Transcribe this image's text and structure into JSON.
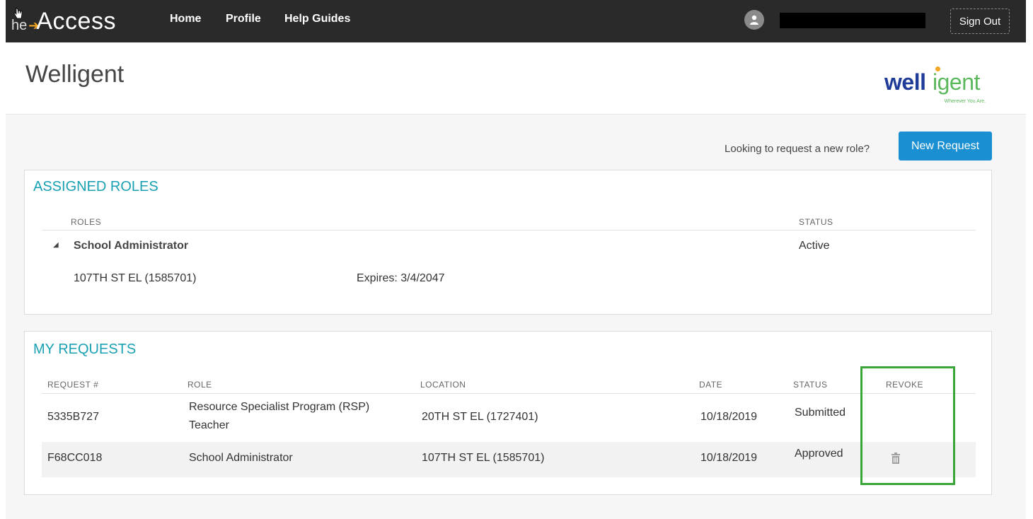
{
  "nav": {
    "brand_the": "he",
    "brand_access": "ccess",
    "links": [
      "Home",
      "Profile",
      "Help Guides"
    ],
    "sign_out": "Sign Out"
  },
  "header": {
    "title": "Welligent",
    "logo_well": "well",
    "logo_igent": "igent",
    "logo_tagline": "Wherever You Are."
  },
  "request_bar": {
    "prompt": "Looking to request a new role?",
    "button": "New Request"
  },
  "assigned_roles": {
    "title": "ASSIGNED ROLES",
    "columns": {
      "roles": "ROLES",
      "status": "STATUS"
    },
    "role": {
      "name": "School Administrator",
      "status": "Active",
      "location": "107TH ST EL (1585701)",
      "expires": "Expires: 3/4/2047"
    }
  },
  "my_requests": {
    "title": "MY REQUESTS",
    "columns": {
      "request": "REQUEST #",
      "role": "ROLE",
      "location": "LOCATION",
      "date": "DATE",
      "status": "STATUS",
      "revoke": "REVOKE"
    },
    "rows": [
      {
        "request": "5335B727",
        "role_line1": "Resource Specialist Program (RSP)",
        "role_line2": "Teacher",
        "location": "20TH ST EL (1727401)",
        "date": "10/18/2019",
        "status": "Submitted"
      },
      {
        "request": "F68CC018",
        "role": "School Administrator",
        "location": "107TH ST EL (1585701)",
        "date": "10/18/2019",
        "status": "Approved",
        "revoke_icon": "trash-icon"
      }
    ]
  },
  "colors": {
    "accent": "#1aa0b3",
    "button": "#1a8fd1",
    "highlight": "#3aa63a",
    "topbar": "#2a2a2a"
  }
}
